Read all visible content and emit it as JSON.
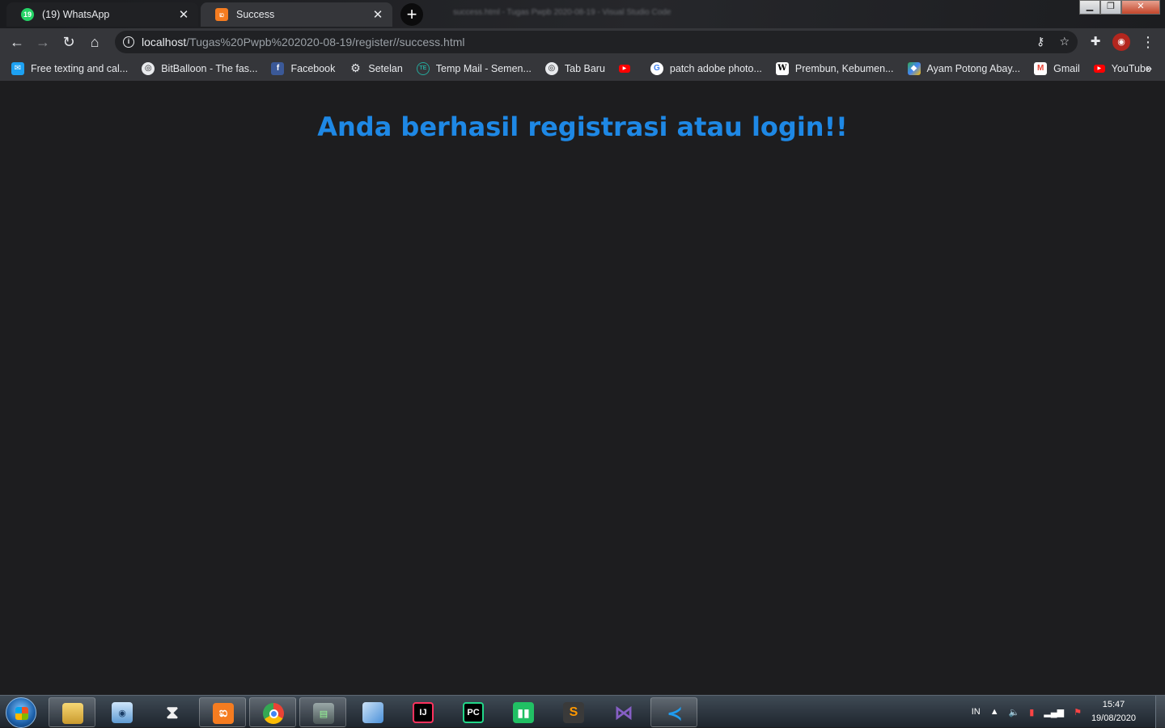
{
  "tabs": [
    {
      "title": "(19) WhatsApp",
      "favicon": "whatsapp-icon",
      "badge": "19"
    },
    {
      "title": "Success",
      "favicon": "xampp-icon"
    }
  ],
  "window_title_blurred": "success.html - Tugas Pwpb 2020-08-19 - Visual Studio Code",
  "url": {
    "host": "localhost",
    "path": "/Tugas%20Pwpb%202020-08-19/register//success.html"
  },
  "bookmarks": [
    {
      "label": "Free texting and cal...",
      "icon": "textfree-icon",
      "color": "#1da1f2"
    },
    {
      "label": "BitBalloon - The fas...",
      "icon": "globe-icon",
      "color": "#5f6368"
    },
    {
      "label": "Facebook",
      "icon": "facebook-icon",
      "color": "#3b5998"
    },
    {
      "label": "Setelan",
      "icon": "gear-icon",
      "color": "#5f6368"
    },
    {
      "label": "Temp Mail - Semen...",
      "icon": "tempmail-icon",
      "color": "#26a69a"
    },
    {
      "label": "Tab Baru",
      "icon": "globe-icon",
      "color": "#5f6368"
    },
    {
      "label": "",
      "icon": "youtube-icon",
      "color": "#ff0000"
    },
    {
      "label": "patch adobe photo...",
      "icon": "google-icon",
      "color": "#ffffff"
    },
    {
      "label": "Prembun, Kebumen...",
      "icon": "wikipedia-icon",
      "color": "#ffffff"
    },
    {
      "label": "Ayam Potong Abay...",
      "icon": "maps-icon",
      "color": "#34a853"
    },
    {
      "label": "Gmail",
      "icon": "gmail-icon",
      "color": "#ea4335"
    },
    {
      "label": "YouTube",
      "icon": "youtube-icon",
      "color": "#ff0000"
    }
  ],
  "page": {
    "headline": "Anda berhasil registrasi atau login!!",
    "headline_color": "#1e88e5"
  },
  "taskbar": {
    "items": [
      {
        "name": "file-explorer",
        "label": "",
        "color": "#e8c25a"
      },
      {
        "name": "camera-app",
        "label": "",
        "color": "#6fa8dc"
      },
      {
        "name": "hourglass-app",
        "label": "",
        "color": "#d9d9d9"
      },
      {
        "name": "xampp",
        "label": "ಐ",
        "color": "#f57c20"
      },
      {
        "name": "chrome",
        "label": "",
        "color": "#4285f4"
      },
      {
        "name": "terminal",
        "label": "",
        "color": "#7a8a8a"
      },
      {
        "name": "virtualbox",
        "label": "",
        "color": "#4a90d9"
      },
      {
        "name": "intellij",
        "label": "IJ",
        "color": "#fe315d"
      },
      {
        "name": "pycharm",
        "label": "PC",
        "color": "#21d789"
      },
      {
        "name": "trello-like",
        "label": "",
        "color": "#21c064"
      },
      {
        "name": "sublime",
        "label": "S",
        "color": "#ff9800"
      },
      {
        "name": "visual-studio",
        "label": "",
        "color": "#865fc5"
      },
      {
        "name": "vscode",
        "label": "",
        "color": "#1f9cf0"
      }
    ],
    "tray": {
      "lang": "IN",
      "time": "15:47",
      "date": "19/08/2020"
    }
  }
}
